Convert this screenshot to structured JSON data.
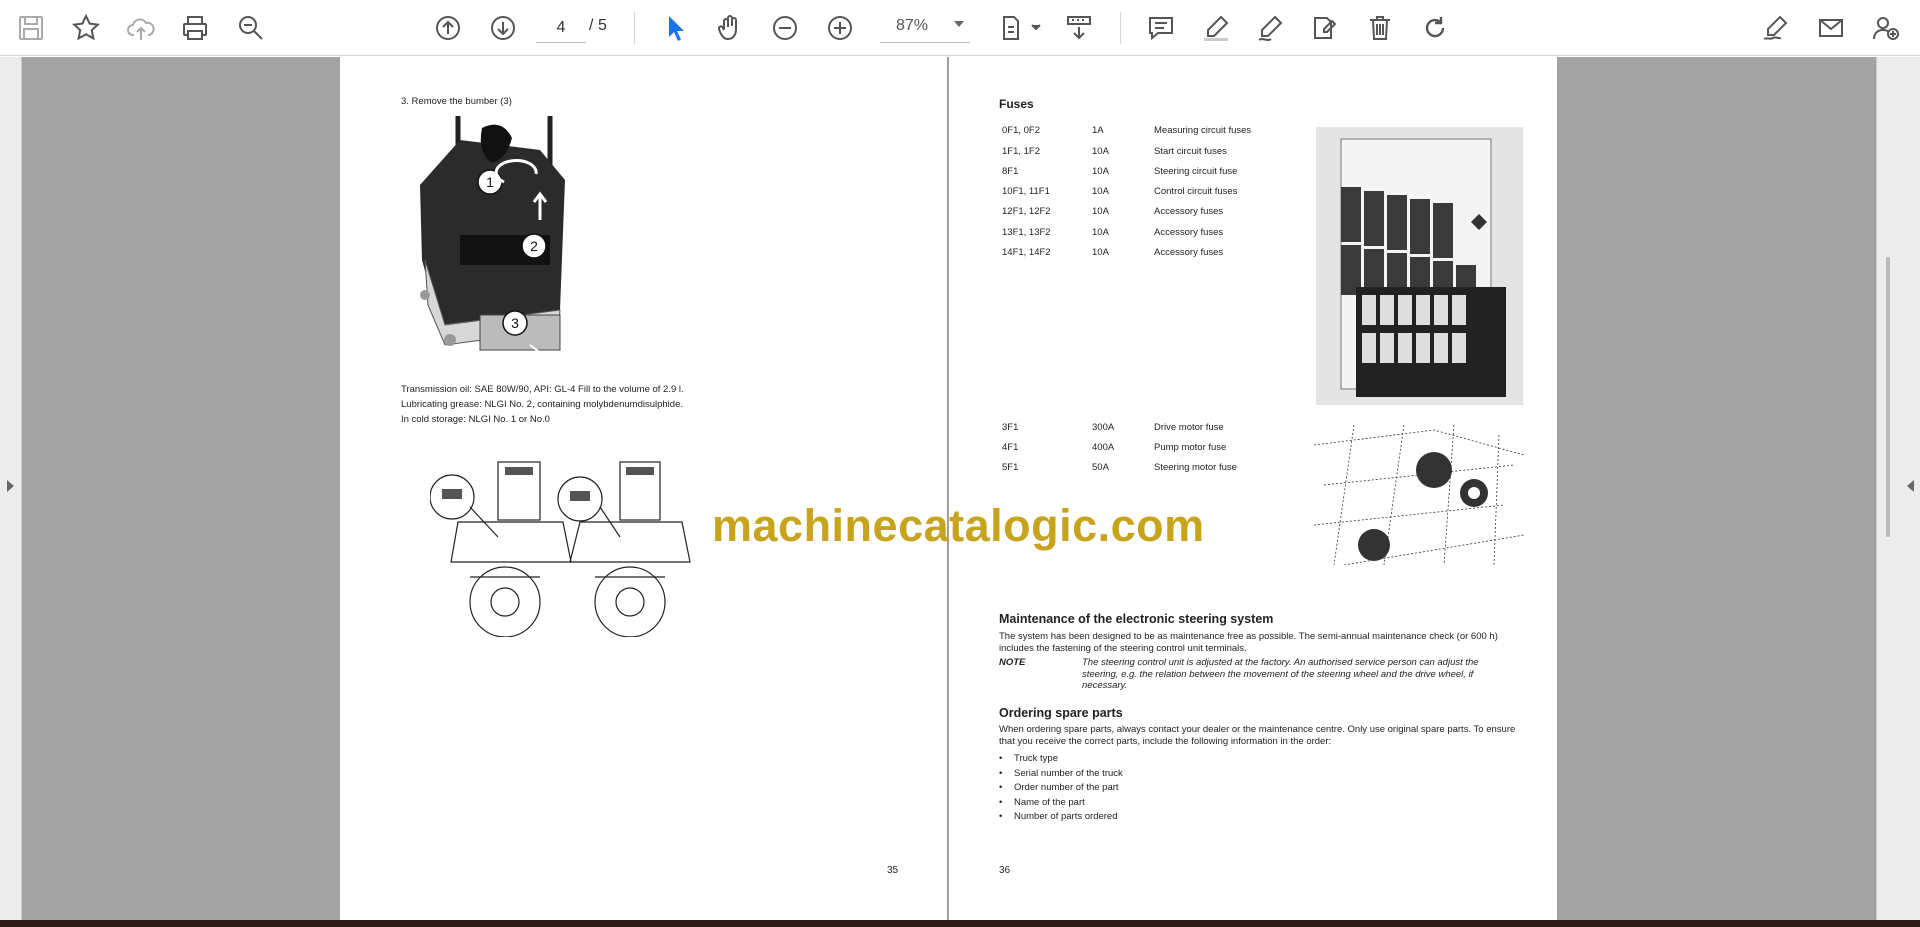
{
  "toolbar": {
    "page_current": "4",
    "page_sep": "/",
    "page_total": "5",
    "zoom": "87%",
    "accent_color": "#1a73e8"
  },
  "left_page": {
    "step": "3.    Remove the bumber (3)",
    "oil_lines": [
      "Transmission oil: SAE 80W/90, API: GL-4 Fill to the volume of 2.9 l.",
      "Lubricating grease: NLGI No. 2, containing molybdenumdisulphide.",
      "In cold storage: NLGI No. 1 or No.0"
    ],
    "figure_callouts": [
      "1",
      "2",
      "3"
    ],
    "page_number": "35"
  },
  "right_page": {
    "fuses_title": "Fuses",
    "fuses_top": [
      {
        "id": "0F1, 0F2",
        "amp": "1A",
        "desc": "Measuring circuit fuses"
      },
      {
        "id": "1F1, 1F2",
        "amp": "10A",
        "desc": "Start circuit fuses"
      },
      {
        "id": "8F1",
        "amp": "10A",
        "desc": "Steering circuit fuse"
      },
      {
        "id": "10F1, 11F1",
        "amp": "10A",
        "desc": "Control circuit fuses"
      },
      {
        "id": "12F1, 12F2",
        "amp": "10A",
        "desc": "Accessory fuses"
      },
      {
        "id": "13F1, 13F2",
        "amp": "10A",
        "desc": "Accessory fuses"
      },
      {
        "id": "14F1, 14F2",
        "amp": "10A",
        "desc": "Accessory fuses"
      }
    ],
    "fuses_bottom": [
      {
        "id": "3F1",
        "amp": "300A",
        "desc": "Drive motor fuse"
      },
      {
        "id": "4F1",
        "amp": "400A",
        "desc": "Pump motor fuse"
      },
      {
        "id": "5F1",
        "amp": "50A",
        "desc": "Steering motor fuse"
      }
    ],
    "maintenance_title": "Maintenance of the electronic steering system",
    "maintenance_text": "The system has been designed to be as maintenance free as possible. The semi-annual maintenance check (or 600 h) includes the fastening of the steering control unit terminals.",
    "note_label": "NOTE",
    "note_text": "The steering control unit is adjusted at the factory. An authorised service person can adjust the steering, e.g. the relation between the movement of the steering wheel and the drive wheel, if necessary.",
    "spare_title": "Ordering spare parts",
    "spare_text": "When ordering spare parts, always contact your dealer or the maintenance centre. Only use original spare parts. To ensure that you receive the correct parts, include the following information in the order:",
    "spare_items": [
      "Truck type",
      "Serial number of the truck",
      "Order number of the part",
      "Name of the part",
      "Number of parts ordered"
    ],
    "page_number": "36"
  },
  "watermark": "machinecatalogic.com"
}
